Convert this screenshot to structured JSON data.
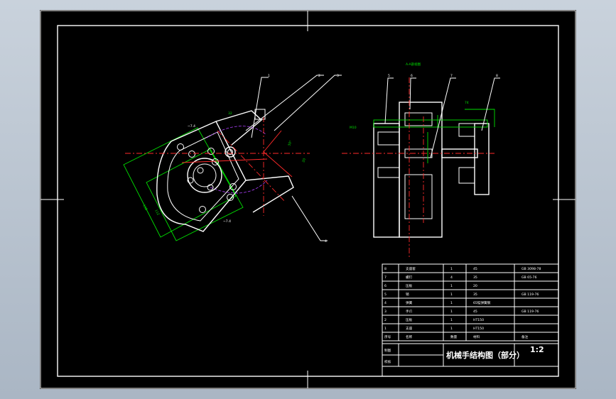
{
  "drawing": {
    "title": "机械手结构图（部分）",
    "scale": "1:2",
    "section_label": "A-A剖视图",
    "dim_green_left": "M10",
    "leaders_left": [
      "1",
      "2",
      "3",
      "4"
    ],
    "leaders_right": [
      "5",
      "6",
      "7",
      "8"
    ]
  },
  "title_block": {
    "rows": [
      {
        "no": "8",
        "name": "支座套",
        "qty": "1",
        "material": "45",
        "std": "GB 3098-78"
      },
      {
        "no": "7",
        "name": "螺钉",
        "qty": "4",
        "material": "35",
        "std": "GB 65-76"
      },
      {
        "no": "6",
        "name": "压板",
        "qty": "1",
        "material": "20",
        "std": ""
      },
      {
        "no": "5",
        "name": "销",
        "qty": "1",
        "material": "35",
        "std": "GB 119-76"
      },
      {
        "no": "4",
        "name": "弹簧",
        "qty": "1",
        "material": "65锰弹簧钢",
        "std": ""
      },
      {
        "no": "3",
        "name": "手爪",
        "qty": "1",
        "material": "45",
        "std": "GB 119-76"
      },
      {
        "no": "2",
        "name": "压板",
        "qty": "1",
        "material": "HT150",
        "std": ""
      },
      {
        "no": "1",
        "name": "支座",
        "qty": "1",
        "material": "HT150",
        "std": ""
      }
    ],
    "header": {
      "no": "序号",
      "name": "名称",
      "qty": "数量",
      "material": "材料",
      "std": "备注"
    },
    "roles": [
      "制图",
      "校核"
    ]
  }
}
